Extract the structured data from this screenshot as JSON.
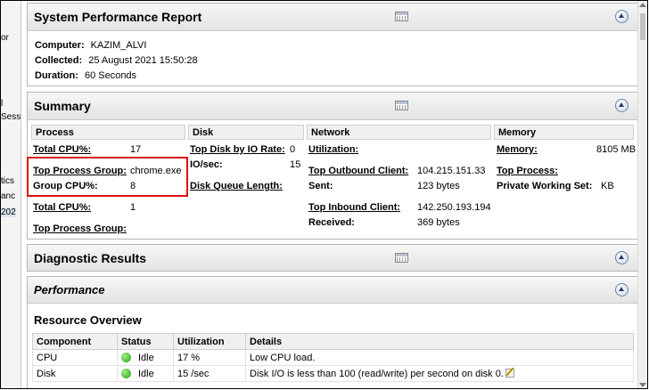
{
  "left_strip": [
    "or",
    "l",
    "Sess",
    "tics",
    "anc",
    "202"
  ],
  "report": {
    "title": "System Performance Report",
    "info": [
      {
        "label": "Computer:",
        "value": "KAZIM_ALVI"
      },
      {
        "label": "Collected:",
        "value": "25 August 2021 15:50:28"
      },
      {
        "label": "Duration:",
        "value": "60 Seconds"
      }
    ]
  },
  "summary": {
    "title": "Summary",
    "columns": [
      "Process",
      "Disk",
      "Network",
      "Memory"
    ],
    "process": {
      "total_cpu_label": "Total CPU%:",
      "total_cpu_value": "17",
      "top_group_label": "Top Process Group:",
      "top_group_value": "chrome.exe",
      "group_cpu_label": "Group CPU%:",
      "group_cpu_value": "8",
      "total_cpu2_label": "Total CPU%:",
      "total_cpu2_value": "1",
      "top_group2_label": "Top Process Group:"
    },
    "disk": {
      "top_disk_label": "Top Disk by IO Rate:",
      "top_disk_value": "0",
      "iosec_label": "IO/sec:",
      "iosec_value": "15",
      "queue_label": "Disk Queue Length:"
    },
    "network": {
      "util_label": "Utilization:",
      "outbound_label": "Top Outbound Client:",
      "outbound_value": "104.215.151.33",
      "sent_label": "Sent:",
      "sent_value": "123 bytes",
      "inbound_label": "Top Inbound Client:",
      "inbound_value": "142.250.193.194",
      "received_label": "Received:",
      "received_value": "369 bytes"
    },
    "memory": {
      "memory_label": "Memory:",
      "memory_value": "8105 MB",
      "top_process_label": "Top Process:",
      "private_ws_label": "Private Working Set:",
      "private_ws_value": "KB"
    }
  },
  "diagnostic": {
    "title": "Diagnostic Results"
  },
  "performance": {
    "title": "Performance"
  },
  "resource": {
    "title": "Resource Overview",
    "headers": [
      "Component",
      "Status",
      "Utilization",
      "Details"
    ],
    "rows": [
      {
        "component": "CPU",
        "status": "Idle",
        "utilization": "17 %",
        "details": "Low CPU load."
      },
      {
        "component": "Disk",
        "status": "Idle",
        "utilization": "15 /sec",
        "details": "Disk I/O is less than 100 (read/write) per second on disk 0."
      }
    ]
  },
  "icons": {
    "grid": "table-view-icon",
    "collapse": "collapse-up-icon",
    "status_ok": "green-status-icon",
    "note": "edit-note-icon"
  }
}
